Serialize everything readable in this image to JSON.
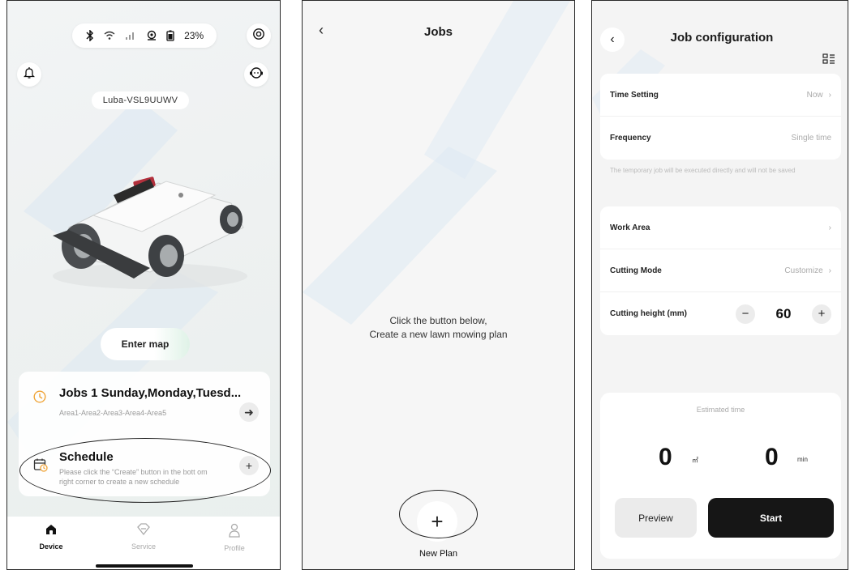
{
  "device_screen": {
    "status": {
      "battery_percent": "23%"
    },
    "device_name": "Luba-VSL9UUWV",
    "enter_map_label": "Enter map",
    "job_card": {
      "title": "Jobs 1 Sunday,Monday,Tuesd...",
      "areas": "Area1-Area2-Area3-Area4-Area5"
    },
    "schedule_card": {
      "title": "Schedule",
      "description": "Please click the “Create” button in the bott om right corner to create a new schedule"
    },
    "tabs": [
      {
        "label": "Device",
        "icon": "home-icon",
        "active": true
      },
      {
        "label": "Service",
        "icon": "diamond-icon",
        "active": false
      },
      {
        "label": "Profile",
        "icon": "person-icon",
        "active": false
      }
    ]
  },
  "jobs_screen": {
    "title": "Jobs",
    "empty_line1": "Click the button below,",
    "empty_line2": "Create a new lawn mowing plan",
    "new_plan_label": "New Plan"
  },
  "config_screen": {
    "title": "Job configuration",
    "time_setting": {
      "label": "Time Setting",
      "value": "Now"
    },
    "frequency": {
      "label": "Frequency",
      "value": "Single time"
    },
    "note": "The temporary job will be executed directly and will not be saved",
    "work_area": {
      "label": "Work Area"
    },
    "cutting_mode": {
      "label": "Cutting Mode",
      "value": "Customize"
    },
    "cutting_height": {
      "label": "Cutting height (mm)",
      "value": "60"
    },
    "estimate": {
      "title": "Estimated time",
      "area_value": "0",
      "area_unit": "㎡",
      "time_value": "0",
      "time_unit": "min"
    },
    "preview_label": "Preview",
    "start_label": "Start"
  },
  "colors": {
    "accent_orange": "#f0a437",
    "start_button": "#161616",
    "watermark": "#d6e6f3"
  }
}
